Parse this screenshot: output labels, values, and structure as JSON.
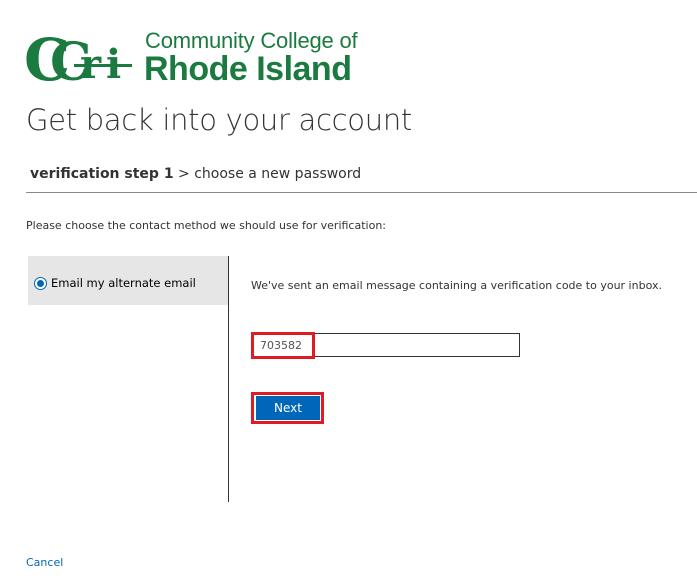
{
  "logo": {
    "line1": "Community College of",
    "line2": "Rhode Island",
    "mark_text": "CCRI",
    "brand_color": "#1b7a3f"
  },
  "page": {
    "title": "Get back into your account"
  },
  "breadcrumb": {
    "current_step": "verification step 1",
    "separator": ">",
    "next_step": "choose a new password"
  },
  "prompt": "Please choose the contact method we should use for verification:",
  "methods": {
    "items": [
      {
        "label": "Email my alternate email",
        "selected": true
      }
    ]
  },
  "verification": {
    "message": "We've sent an email message containing a verification code to your inbox.",
    "code_value": "703582",
    "next_label": "Next"
  },
  "footer": {
    "cancel_label": "Cancel"
  },
  "colors": {
    "accent": "#0067b8",
    "highlight": "#e01b24",
    "panel_bg": "#e6e6e6"
  }
}
